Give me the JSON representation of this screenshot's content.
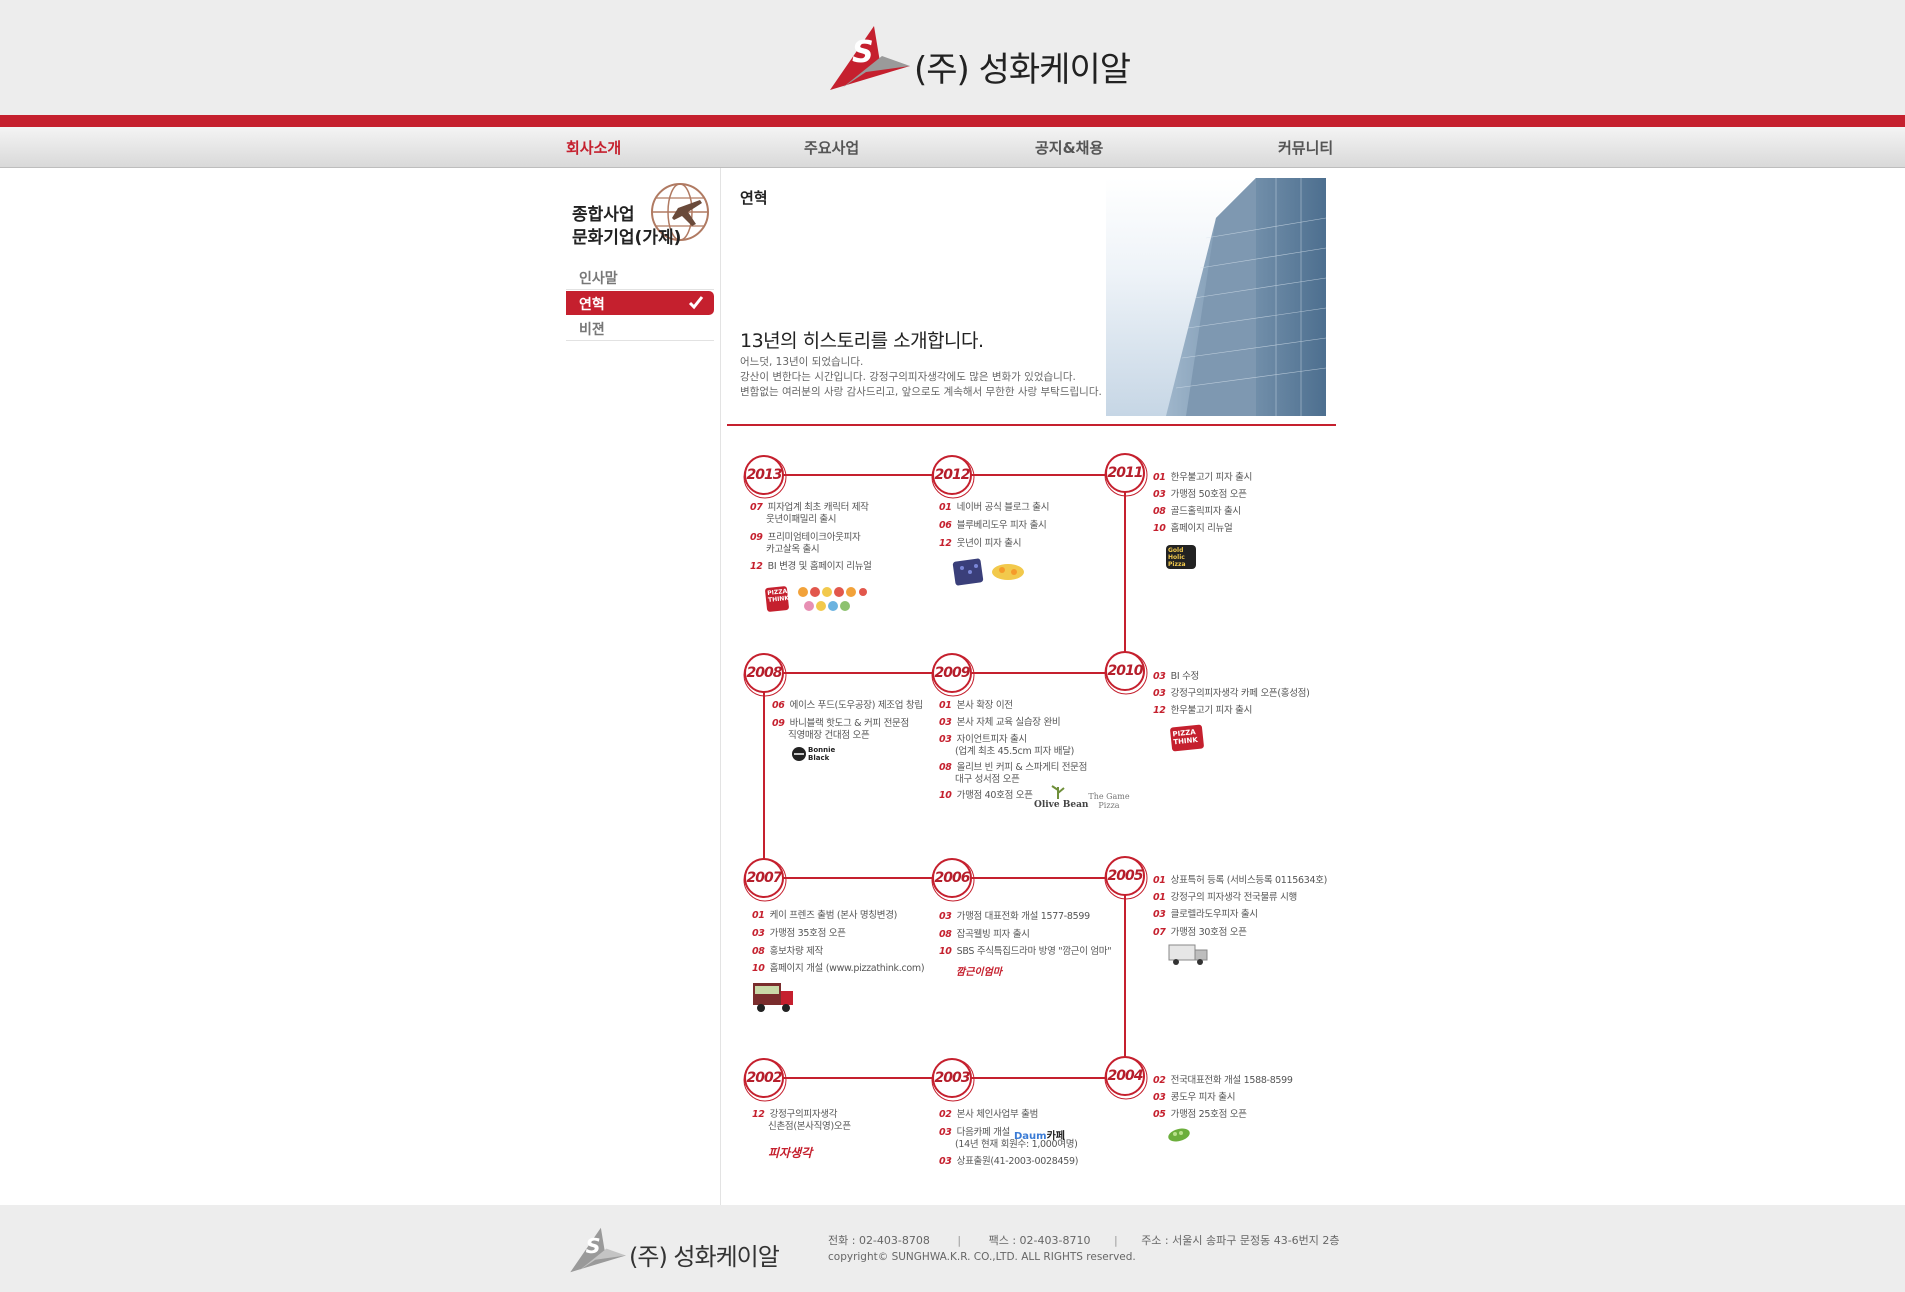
{
  "company": {
    "name": "(주) 성화케이알"
  },
  "nav": [
    {
      "label": "회사소개"
    },
    {
      "label": "주요사업"
    },
    {
      "label": "공지&채용"
    },
    {
      "label": "커뮤니티"
    }
  ],
  "sidebar": {
    "title_line1": "종합사업",
    "title_line2": "문화기업(가제)",
    "items": [
      {
        "label": "인사말"
      },
      {
        "label": "연혁"
      },
      {
        "label": "비젼"
      }
    ]
  },
  "page": {
    "title": "연혁",
    "intro_head": "13년의 히스토리를 소개합니다.",
    "intro_lines": [
      "어느덧, 13년이 되었습니다.",
      "강산이 변한다는 시간입니다. 강정구의피자생각에도 많은 변화가 있었습니다.",
      "변함없는 여러분의 사랑 감사드리고, 앞으로도 계속해서 무한한 사랑 부탁드립니다."
    ]
  },
  "timeline": [
    {
      "year": "2013",
      "events": [
        {
          "month": "07",
          "text": "피자업계 최초 캐릭터 제작",
          "cont": "웃년이패밀리 출시"
        },
        {
          "month": "09",
          "text": "프리미엄테이크아웃피자",
          "cont": "카고살옥 출시"
        },
        {
          "month": "12",
          "text": "BI 변경 및 홈페이지 리뉴얼"
        }
      ]
    },
    {
      "year": "2012",
      "events": [
        {
          "month": "01",
          "text": "네이버 공식 블로그 출시"
        },
        {
          "month": "06",
          "text": "블루베리도우 피자 출시"
        },
        {
          "month": "12",
          "text": "웃년이 피자 출시"
        }
      ]
    },
    {
      "year": "2011",
      "events": [
        {
          "month": "01",
          "text": "한우불고기 피자 출시"
        },
        {
          "month": "03",
          "text": "가맹점 50호점 오픈"
        },
        {
          "month": "08",
          "text": "골드홀릭피자 출시"
        },
        {
          "month": "10",
          "text": "홈페이지 리뉴얼"
        }
      ]
    },
    {
      "year": "2008",
      "events": [
        {
          "month": "06",
          "text": "에이스 푸드(도우공장) 제조업 창립"
        },
        {
          "month": "09",
          "text": "바니블랙 핫도그 & 커피 전문점",
          "cont": "직영매장 건대점 오픈"
        }
      ]
    },
    {
      "year": "2009",
      "events": [
        {
          "month": "01",
          "text": "본사 확장 이전"
        },
        {
          "month": "03",
          "text": "본사 자체 교육 실습장 완비"
        },
        {
          "month": "03",
          "text": "자이언트피자 출시",
          "cont": "(업계 최초 45.5cm 피자 배달)"
        },
        {
          "month": "08",
          "text": "올리브 빈 커피 & 스파게티 전문점",
          "cont": "대구 성서점 오픈"
        },
        {
          "month": "10",
          "text": "가맹점 40호점 오픈"
        }
      ]
    },
    {
      "year": "2010",
      "events": [
        {
          "month": "03",
          "text": "BI 수정"
        },
        {
          "month": "03",
          "text": "강정구의피자생각 카페 오픈(홍성점)"
        },
        {
          "month": "12",
          "text": "한우불고기 피자 출시"
        }
      ]
    },
    {
      "year": "2007",
      "events": [
        {
          "month": "01",
          "text": "케이 프렌즈 출범 (본사 명칭변경)"
        },
        {
          "month": "03",
          "text": "가맹점 35호점 오픈"
        },
        {
          "month": "08",
          "text": "홍보차량 제작"
        },
        {
          "month": "10",
          "text": "홈페이지 개설 (www.pizzathink.com)"
        }
      ]
    },
    {
      "year": "2006",
      "events": [
        {
          "month": "03",
          "text": "가맹점 대표전화 개설 1577-8599"
        },
        {
          "month": "08",
          "text": "잡곡웰빙 피자 출시"
        },
        {
          "month": "10",
          "text": "SBS 주식특집드라마 방영 \"깜근이 엄마\""
        }
      ]
    },
    {
      "year": "2005",
      "events": [
        {
          "month": "01",
          "text": "상표특허 등록 (서비스등록 0115634호)"
        },
        {
          "month": "01",
          "text": "강정구의 피자생각 전국물류 시행"
        },
        {
          "month": "03",
          "text": "클로렐라도우피자 출시"
        },
        {
          "month": "07",
          "text": "가맹점 30호점 오픈"
        }
      ]
    },
    {
      "year": "2002",
      "events": [
        {
          "month": "12",
          "text": "강정구의피자생각",
          "cont": "신촌점(본사직영)오픈"
        }
      ]
    },
    {
      "year": "2003",
      "events": [
        {
          "month": "02",
          "text": "본사 체인사업부 출범"
        },
        {
          "month": "03",
          "text": "다음카페 개설",
          "cont": "(14년 현재 회원수: 1,000여명)"
        },
        {
          "month": "03",
          "text": "상표출원(41-2003-0028459)"
        }
      ]
    },
    {
      "year": "2004",
      "events": [
        {
          "month": "02",
          "text": "전국대표전화 개설 1588-8599"
        },
        {
          "month": "03",
          "text": "콩도우 피자 출시"
        },
        {
          "month": "05",
          "text": "가맹점 25호점 오픈"
        }
      ]
    }
  ],
  "logos": {
    "pizza_think": "PIZZA THINK",
    "gold_holic": "Gold Holic Pizza",
    "bonnie_black": "Bonnie Black",
    "olive_bean": "Olive Bean",
    "game_pizza": "The Game Pizza",
    "daum": "Daum",
    "daum_cafe": "카페",
    "kkamgeun": "깜근이엄마",
    "pizza_saenggak": "피자생각"
  },
  "footer": {
    "phone": "전화 : 02-403-8708",
    "fax": "팩스 : 02-403-8710",
    "address": "주소 : 서울시 송파구 문정동 43-6번지 2층",
    "copyright": "copyright© SUNGHWA.K.R. CO.,LTD. ALL RIGHTS reserved."
  },
  "colors": {
    "brand_red": "#c5202e",
    "header_bg": "#ededed"
  }
}
